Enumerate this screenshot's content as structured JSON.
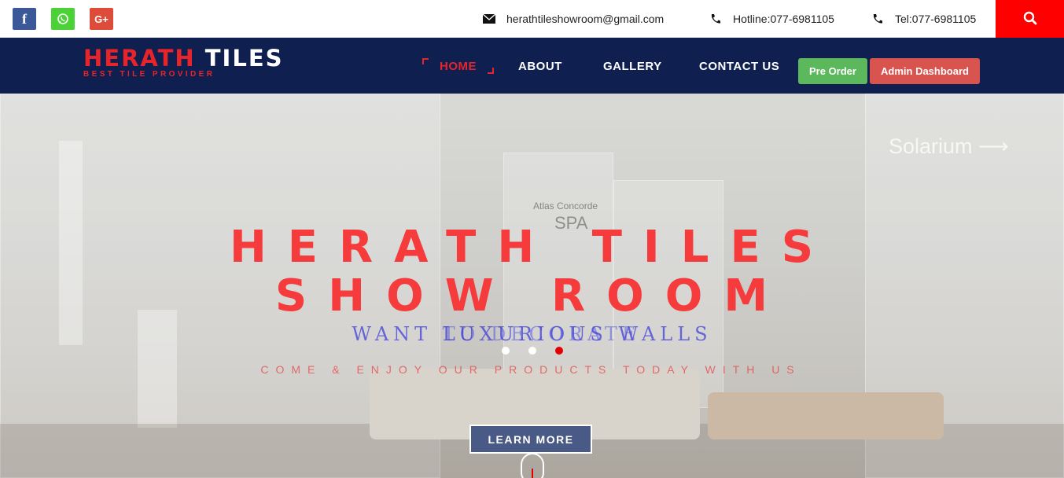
{
  "topbar": {
    "social": [
      {
        "name": "facebook-icon",
        "glyph": "f"
      },
      {
        "name": "whatsapp-icon",
        "glyph": ""
      },
      {
        "name": "google-plus-icon",
        "glyph": "G+"
      }
    ],
    "email": "herathtileshowroom@gmail.com",
    "hotline": "Hotline:077-6981105",
    "tel": "Tel:077-6981105",
    "search_icon": "search-icon"
  },
  "nav": {
    "logo_main_red": "HERATH",
    "logo_main_white": "TILES",
    "logo_sub": "BEST TILE PROVIDER",
    "items": [
      "HOME",
      "ABOUT",
      "GALLERY",
      "CONTACT US"
    ],
    "active": "HOME",
    "pre_order": "Pre Order",
    "admin_dashboard": "Admin Dashboard"
  },
  "hero": {
    "title": "HERATH TILES SHOW ROOM",
    "subtitle_a": "WANT LUXURIOUS WALLS",
    "subtitle_b": "TO DECORATE",
    "tagline": "COME & ENJOY OUR PRODUCTS TODAY WITH US",
    "background_labels": {
      "solarium": "Solarium",
      "brand": "Atlas Concorde",
      "spa": "SPA"
    },
    "learn_more": "LEARN MORE",
    "slides": 3,
    "active_slide": 3
  },
  "colors": {
    "nav_bg": "#0f1f4f",
    "accent_red": "#e8242b",
    "search_bg": "#ff0000",
    "pre_order_bg": "#5cb85c",
    "admin_bg": "#d9534f"
  }
}
